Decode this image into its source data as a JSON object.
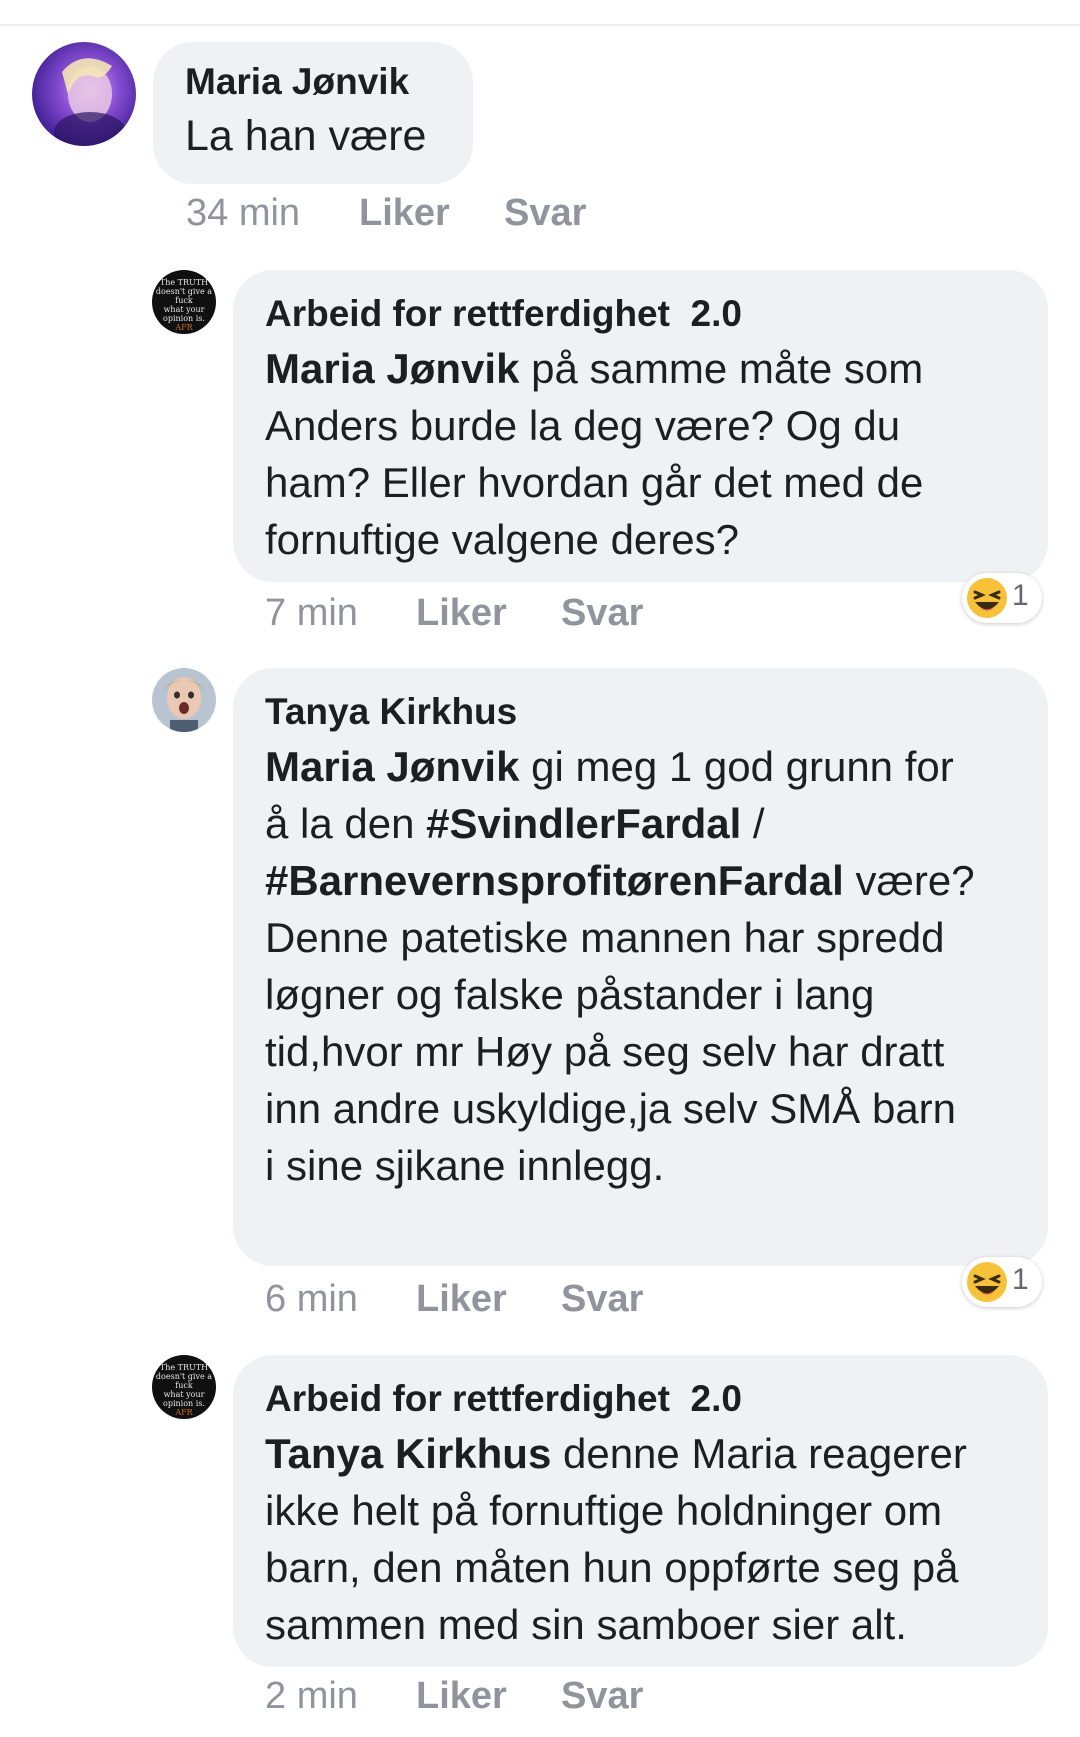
{
  "comments": [
    {
      "author": "Maria Jønvik",
      "text": "La han være",
      "time": "34 min",
      "like": "Liker",
      "reply": "Svar"
    },
    {
      "author": "Arbeid for rettferdighet  2.0",
      "mention": "Maria Jønvik",
      "text_lines": [
        " på samme måte som",
        "Anders burde la deg være? Og du",
        "ham? Eller hvordan går det med de",
        "fornuftige valgene deres?"
      ],
      "time": "7 min",
      "like": "Liker",
      "reply": "Svar",
      "reaction": {
        "icon": "laughing-emoji",
        "count": "1"
      },
      "avatar_text": [
        "The TRUTH",
        "doesn't give a",
        "fuck",
        "what your",
        "opinion is.",
        "AFR"
      ]
    },
    {
      "author": "Tanya Kirkhus",
      "mention": "Maria Jønvik",
      "line1_rest": " gi meg 1 god grunn for",
      "line2_prefix": "å la den ",
      "hashtag1": "#SvindlerFardal",
      "line2_suffix": " /",
      "hashtag2": "#BarnevernsprofitørenFardal",
      "line3_suffix": " være?",
      "text_lines": [
        "Denne patetiske mannen har spredd",
        "løgner og falske påstander i lang",
        "tid,hvor mr Høy på seg selv har dratt",
        "inn andre uskyldige,ja selv SMÅ barn",
        "i sine sjikane innlegg."
      ],
      "time": "6 min",
      "like": "Liker",
      "reply": "Svar",
      "reaction": {
        "icon": "laughing-emoji",
        "count": "1"
      }
    },
    {
      "author": "Arbeid for rettferdighet  2.0",
      "mention": "Tanya Kirkhus",
      "text_lines": [
        " denne Maria reagerer",
        "ikke helt på fornuftige holdninger om",
        "barn, den måten hun oppførte seg på",
        "sammen med sin samboer sier alt."
      ],
      "time": "2 min",
      "like": "Liker",
      "reply": "Svar",
      "avatar_text": [
        "The TRUTH",
        "doesn't give a",
        "fuck",
        "what your",
        "opinion is.",
        "AFR"
      ]
    }
  ],
  "colors": {
    "bubble": "#f0f1f4",
    "meta": "#90949c",
    "text": "#1c1e21"
  }
}
